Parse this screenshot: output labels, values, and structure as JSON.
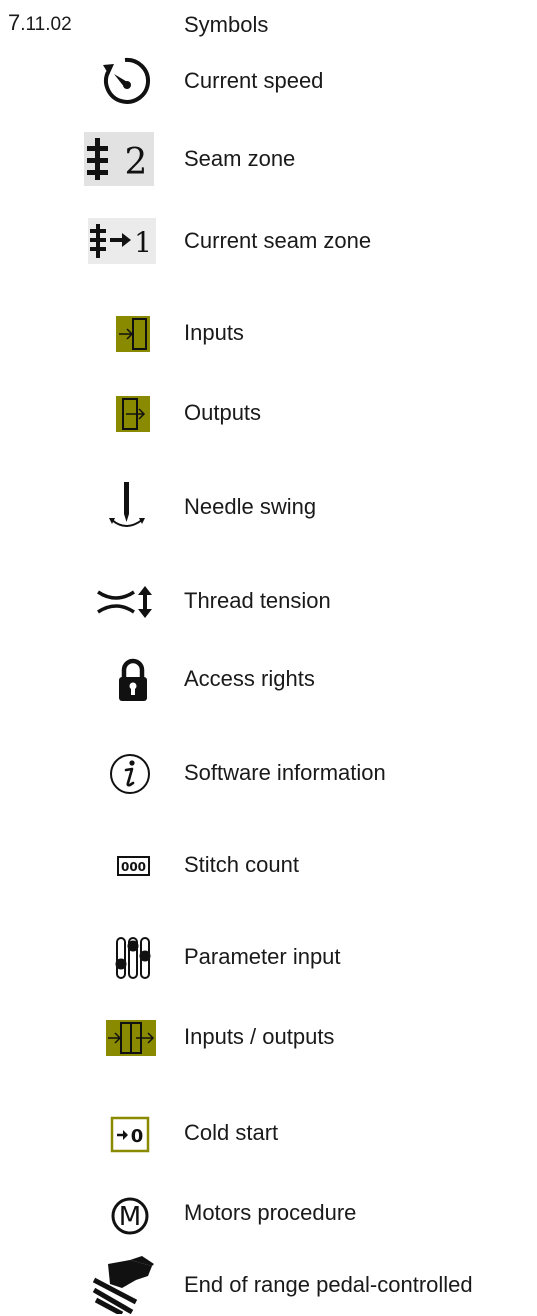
{
  "section": {
    "number_main": "7",
    "number_sub": ".11.02",
    "title": "Symbols"
  },
  "symbols": [
    {
      "label": "Current speed",
      "icon": "speedometer-icon"
    },
    {
      "label": "Seam zone",
      "icon": "seam-zone-icon"
    },
    {
      "label": "Current seam zone",
      "icon": "current-seam-zone-icon"
    },
    {
      "label": "Inputs",
      "icon": "inputs-icon"
    },
    {
      "label": "Outputs",
      "icon": "outputs-icon"
    },
    {
      "label": "Needle swing",
      "icon": "needle-swing-icon"
    },
    {
      "label": "Thread tension",
      "icon": "thread-tension-icon"
    },
    {
      "label": "Access rights",
      "icon": "padlock-icon"
    },
    {
      "label": "Software information",
      "icon": "info-icon"
    },
    {
      "label": "Stitch count",
      "icon": "stitch-counter-icon"
    },
    {
      "label": "Parameter input",
      "icon": "sliders-icon"
    },
    {
      "label": "Inputs / outputs",
      "icon": "inputs-outputs-icon"
    },
    {
      "label": "Cold start",
      "icon": "cold-start-icon"
    },
    {
      "label": "Motors procedure",
      "icon": "motor-icon"
    },
    {
      "label": "End of range pedal-controlled",
      "icon": "pedal-icon"
    }
  ],
  "icon_text": {
    "seam_zone_number": "2",
    "current_seam_zone_number": "1",
    "stitch_count_digits": "000",
    "cold_start_digit": "0",
    "motor_letter": "M"
  },
  "colors": {
    "olive_fill": "#8a8a00",
    "seam_zone_bg": "#e2e2e2",
    "text": "#1a1a1a"
  }
}
